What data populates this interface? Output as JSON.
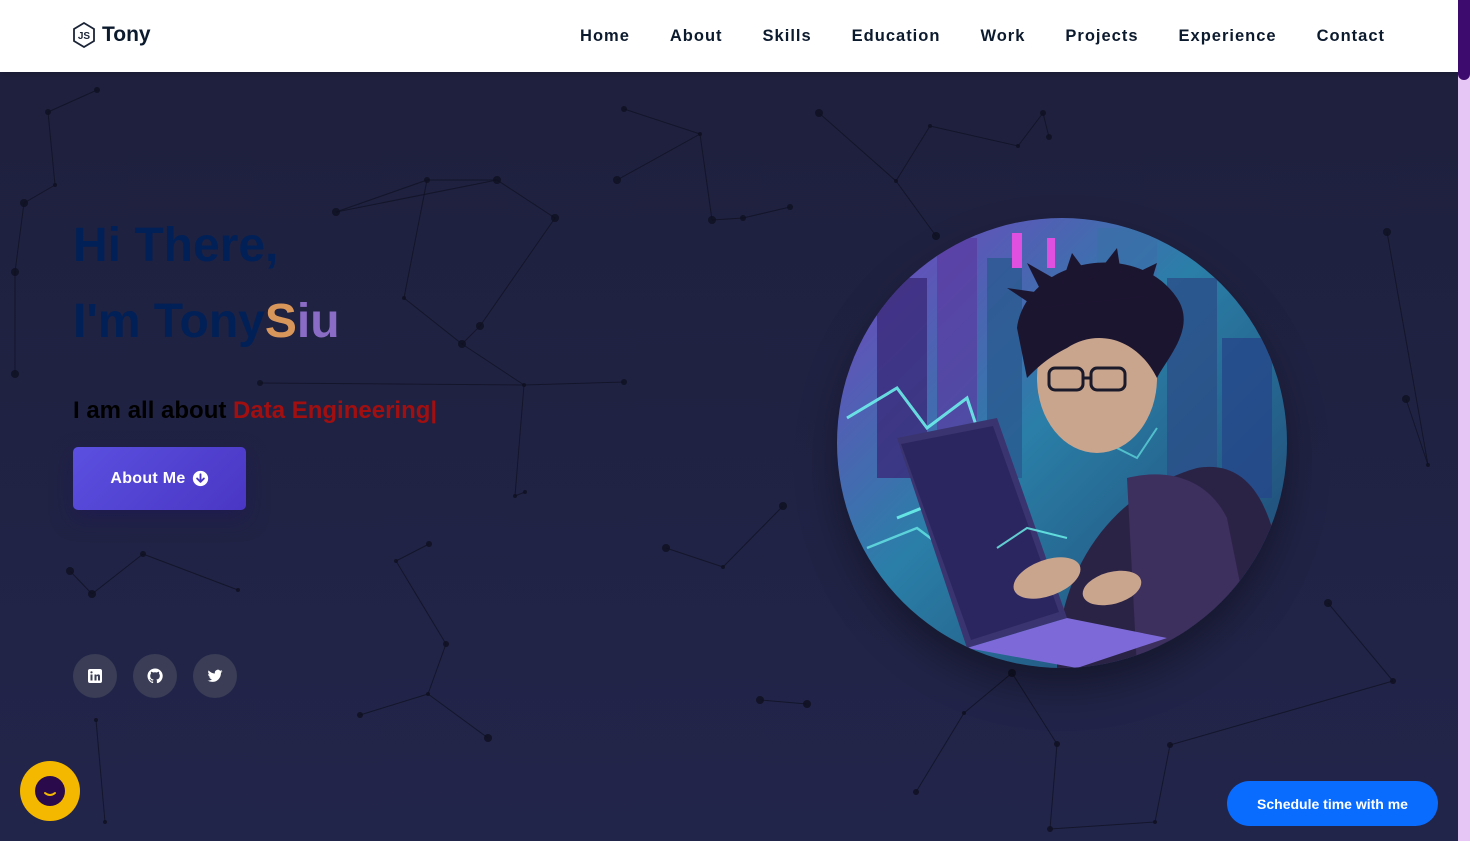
{
  "brand": {
    "name": "Tony",
    "icon": "nodejs-hex-icon"
  },
  "nav": {
    "items": [
      {
        "label": "Home"
      },
      {
        "label": "About"
      },
      {
        "label": "Skills"
      },
      {
        "label": "Education"
      },
      {
        "label": "Work"
      },
      {
        "label": "Projects"
      },
      {
        "label": "Experience"
      },
      {
        "label": "Contact"
      }
    ]
  },
  "hero": {
    "greeting": "Hi There,",
    "intro_prefix": "I'm Tony",
    "intro_s": "S",
    "intro_iu": "iu",
    "tagline_prefix": "I am all about ",
    "tagline_role": "Data Engineering|",
    "about_button": "About Me",
    "socials": [
      {
        "icon": "linkedin-icon"
      },
      {
        "icon": "github-icon"
      },
      {
        "icon": "twitter-icon"
      }
    ]
  },
  "widgets": {
    "schedule_button": "Schedule time with me",
    "chat_icon": "chat-icon"
  },
  "colors": {
    "navbar_bg": "#ffffff",
    "hero_bg": "#20223f",
    "heading": "#002057",
    "accent_orange": "#d9965a",
    "accent_purple": "#8a6cc6",
    "role_red": "#a10f10",
    "button_purple": "#5b50e0",
    "schedule_blue": "#0a6cff",
    "chat_yellow": "#f5b800"
  }
}
